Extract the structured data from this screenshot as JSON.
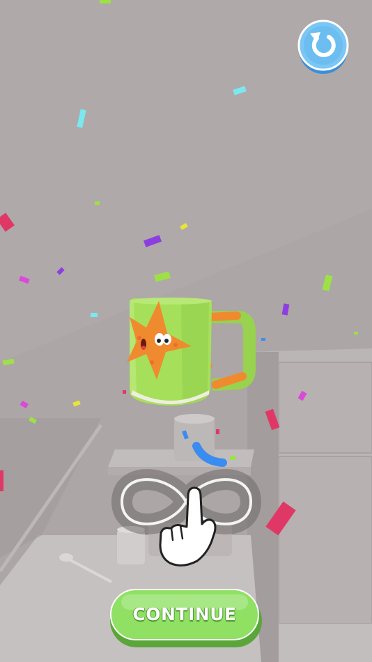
{
  "scene": {
    "background_color": "#aca6a6",
    "object": "mug",
    "mug_color": "#a6e05a",
    "decal": "starfish",
    "decal_color": "#f08a2e"
  },
  "hud": {
    "restart_icon": "restart-icon",
    "gesture_hint_icon": "infinity-swipe-hand-icon"
  },
  "continue_button": {
    "label": "CONTINUE",
    "color": "#8fe063"
  }
}
